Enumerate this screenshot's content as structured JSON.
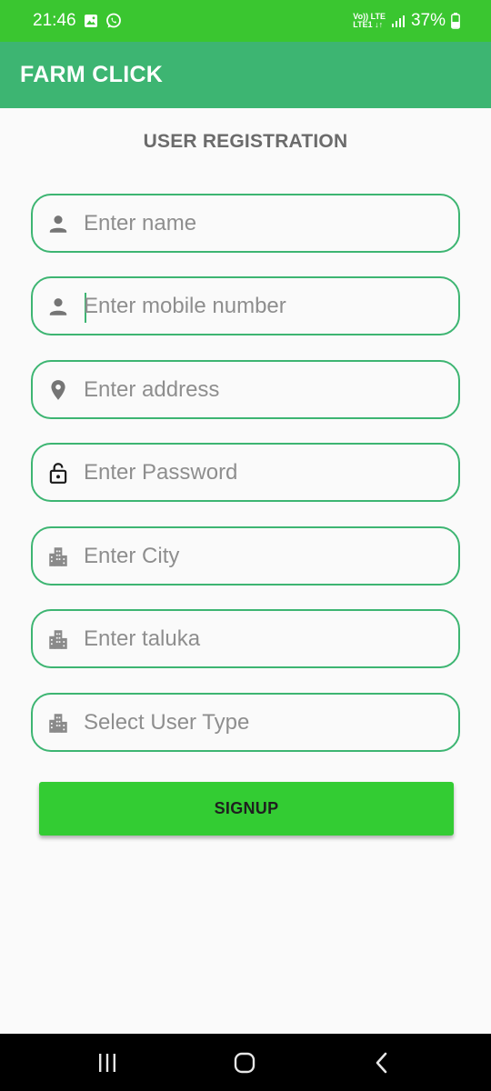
{
  "status_bar": {
    "time": "21:46",
    "network_top": "Vo)) LTE",
    "network_bottom": "LTE1 ↓↑",
    "battery": "37%"
  },
  "app": {
    "title": "FARM CLICK"
  },
  "page": {
    "heading": "USER REGISTRATION"
  },
  "fields": [
    {
      "placeholder": "Enter name",
      "icon": "person-icon"
    },
    {
      "placeholder": "Enter mobile number",
      "icon": "person-icon"
    },
    {
      "placeholder": "Enter address",
      "icon": "location-pin-icon"
    },
    {
      "placeholder": "Enter Password",
      "icon": "lock-icon"
    },
    {
      "placeholder": "Enter City",
      "icon": "city-icon"
    },
    {
      "placeholder": "Enter taluka",
      "icon": "city-icon"
    },
    {
      "placeholder": "Select User Type",
      "icon": "city-icon"
    }
  ],
  "signup": {
    "label": "SIGNUP"
  },
  "colors": {
    "status_bar": "#3ac630",
    "app_bar": "#3db572",
    "field_border": "#3db572",
    "button": "#33cc33"
  }
}
